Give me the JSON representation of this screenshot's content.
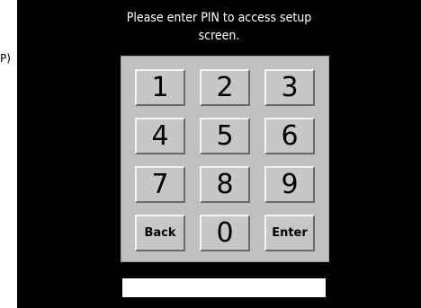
{
  "left_fragment": "P)",
  "title": {
    "line1": "Please enter PIN to access setup",
    "line2": "screen."
  },
  "keypad": {
    "keys": [
      "1",
      "2",
      "3",
      "4",
      "5",
      "6",
      "7",
      "8",
      "9",
      "Back",
      "0",
      "Enter"
    ]
  },
  "pin_field": {
    "value": ""
  },
  "colors": {
    "screen_background": "#000000",
    "keypad_background": "#c0c0c0",
    "title_text": "#ffffff",
    "field_background": "#ffffff"
  }
}
